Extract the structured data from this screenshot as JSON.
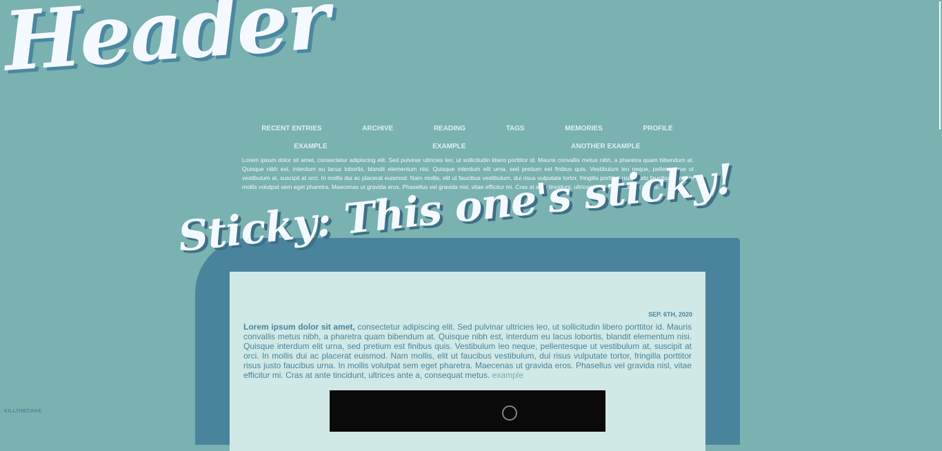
{
  "header": {
    "title": "Header"
  },
  "nav": {
    "row1": [
      "Recent Entries",
      "Archive",
      "Reading",
      "Tags",
      "Memories",
      "Profile"
    ],
    "row2": [
      "Example",
      "Example",
      "Another Example"
    ]
  },
  "intro_text": "Lorem ipsum dolor sit amet, consectetur adipiscing elit. Sed pulvinar ultricies leo, ut sollicitudin libero porttitor id. Mauris convallis metus nibh, a pharetra quam bibendum at. Quisque nibh est, interdum eu lacus lobortis, blandit elementum nisi. Quisque interdum elit urna, sed pretium est finibus quis. Vestibulum leo neque, pellentesque ut vestibulum at, suscipit at orci. In mollis dui ac placerat euismod. Nam mollis, elit ut faucibus vestibulum, dui risus vulputate tortor, fringilla porttitor risus justo faucibus urna. In mollis volutpat sem eget pharetra. Maecenas ut gravida eros. Phasellus vel gravida nisl, vitae efficitur mi. Cras at ante tincidunt, ultrices ante a, consequat metus.",
  "entry": {
    "title": "Sticky: This one's sticky!",
    "date": "Sep. 6th, 2020",
    "lead": "Lorem ipsum dolor sit amet,",
    "body": " consectetur adipiscing elit. Sed pulvinar ultricies leo, ut sollicitudin libero porttitor id. Mauris convallis metus nibh, a pharetra quam bibendum at. Quisque nibh est, interdum eu lacus lobortis, blandit elementum nisi. Quisque interdum elit urna, sed pretium est finibus quis. Vestibulum leo neque, pellentesque ut vestibulum at, suscipit at orci. In mollis dui ac placerat euismod. Nam mollis, elit ut faucibus vestibulum, dui risus vulputate tortor, fringilla porttitor risus justo faucibus urna. In mollis volutpat sem eget pharetra. Maecenas ut gravida eros. Phasellus vel gravida nisl, vitae efficitur mi. Cras at ante tincidunt, ultrices ante a, consequat metus.",
    "link": "example"
  },
  "credit": "KILLTHECAKE",
  "colors": {
    "background": "#7ab1b1",
    "card": "#4a849c",
    "paper": "#d0e8e6",
    "title_text": "#f4f9ff"
  }
}
